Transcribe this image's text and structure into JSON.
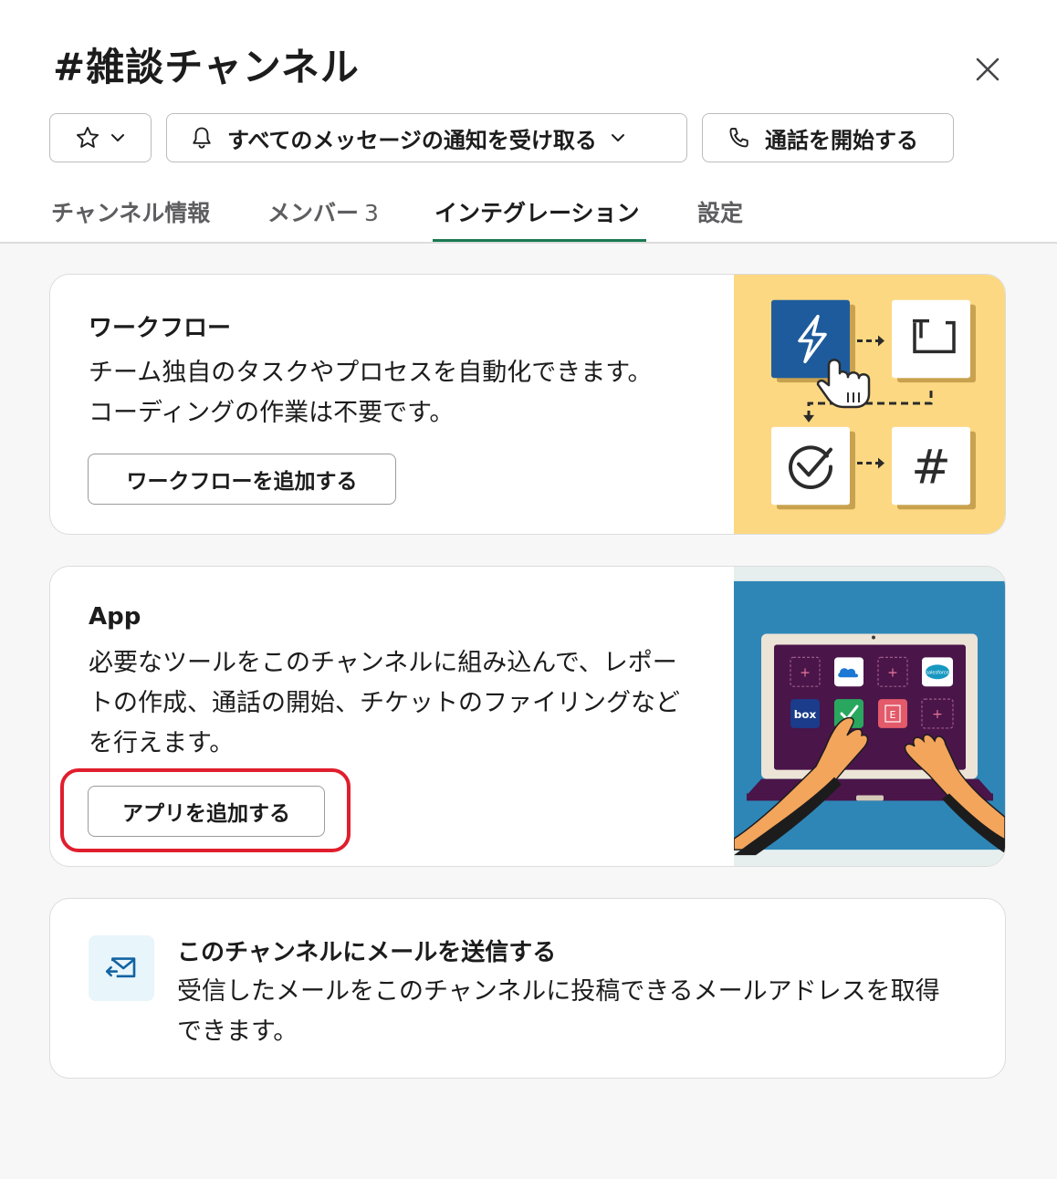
{
  "header": {
    "title": "#雑談チャンネル",
    "notify_label": "すべてのメッセージの通知を受け取る",
    "call_label": "通話を開始する"
  },
  "tabs": [
    {
      "label": "チャンネル情報"
    },
    {
      "label": "メンバー",
      "count": "3"
    },
    {
      "label": "インテグレーション",
      "active": true
    },
    {
      "label": "設定"
    }
  ],
  "workflow": {
    "title": "ワークフロー",
    "description": "チーム独自のタスクやプロセスを自動化できます。コーディングの作業は不要です。",
    "button_label": "ワークフローを追加する",
    "illustration_bg": "#fdd882",
    "illustration": {
      "hash_tile": "#"
    }
  },
  "apps": {
    "title": "App",
    "description": "必要なツールをこのチャンネルに組み込んで、レポートの作成、通話の開始、チケットのファイリングなどを行えます。",
    "button_label": "アプリを追加する",
    "illustration_bg": "#2e86b7",
    "tiles": [
      "+",
      "onedrive",
      "+",
      "salesforce",
      "box",
      "check",
      "E",
      "+"
    ],
    "tile_labels": {
      "box": "box",
      "salesforce": "salesforce",
      "evernote": "E"
    }
  },
  "email": {
    "title": "このチャンネルにメールを送信する",
    "description": "受信したメールをこのチャンネルに投稿できるメールアドレスを取得できます。"
  },
  "colors": {
    "accent": "#1a7a52",
    "highlight": "#e01e2d"
  }
}
